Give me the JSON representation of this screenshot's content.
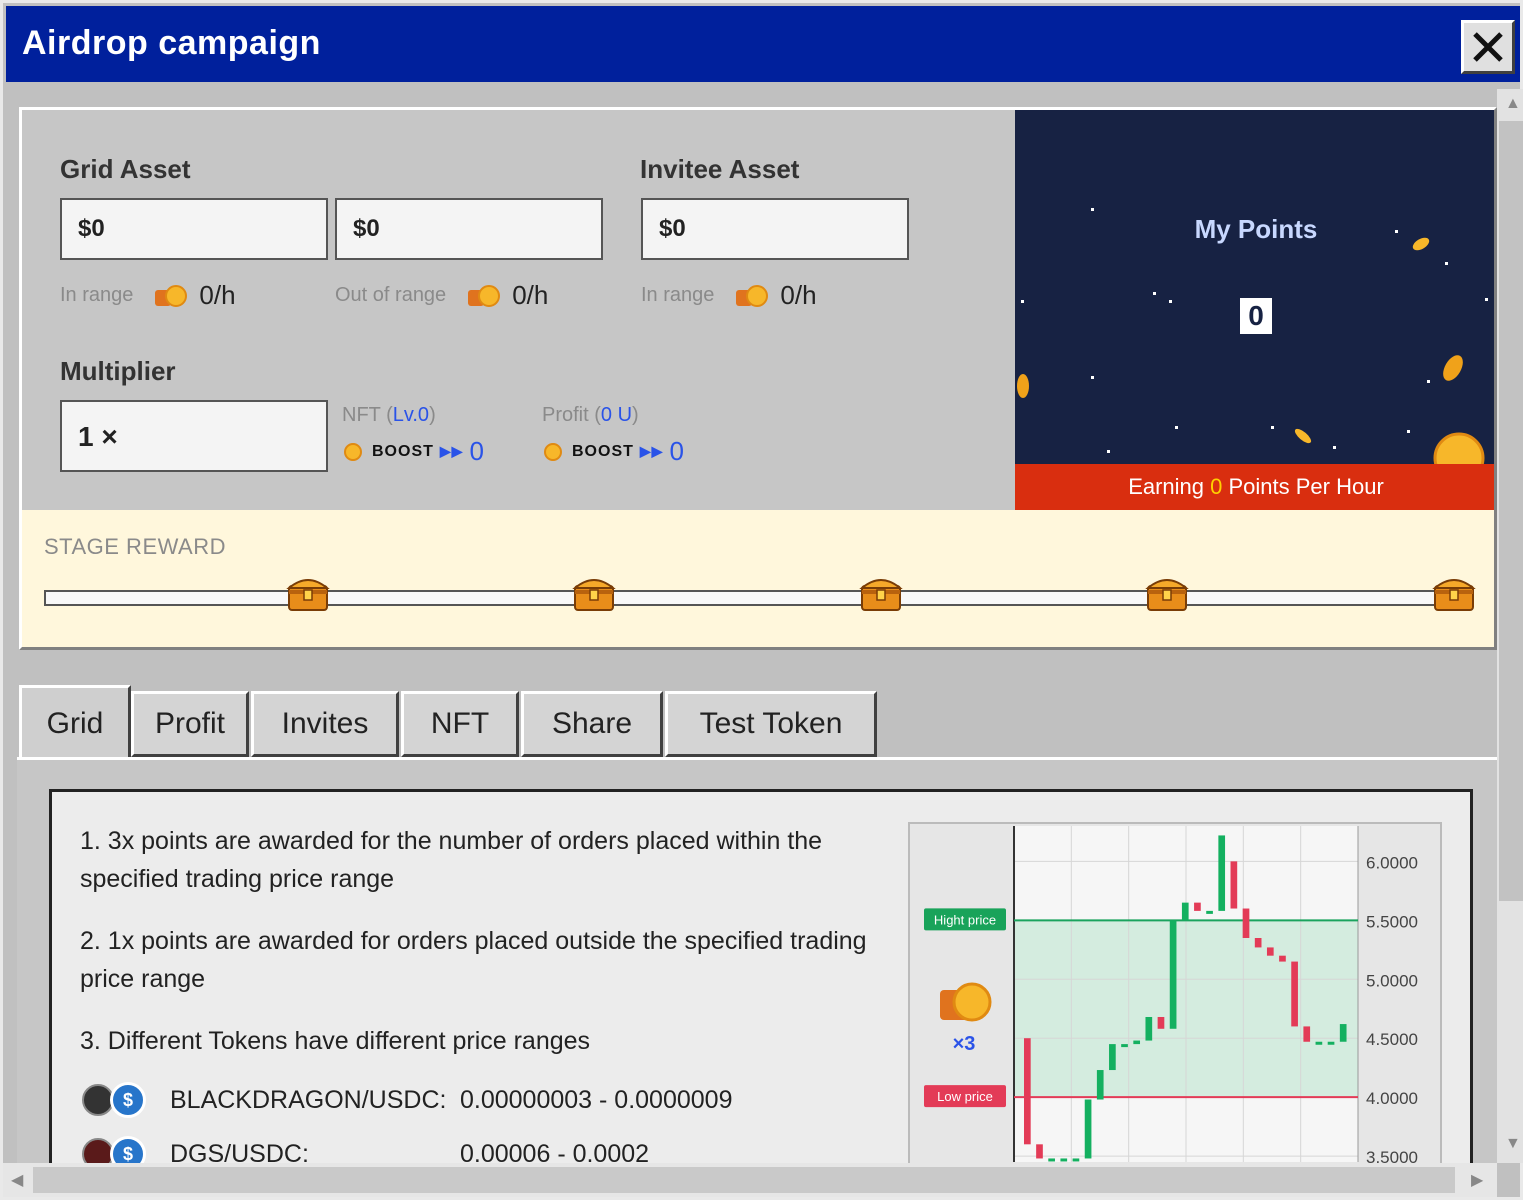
{
  "window": {
    "title": "Airdrop campaign"
  },
  "assets": {
    "grid_label": "Grid Asset",
    "invitee_label": "Invitee Asset",
    "grid_in_value": "$0",
    "grid_out_value": "$0",
    "invitee_value": "$0",
    "grid_in_caption": "In range",
    "grid_out_caption": "Out of range",
    "invitee_caption": "In range",
    "grid_in_rate": "0/h",
    "grid_out_rate": "0/h",
    "invitee_rate": "0/h"
  },
  "multiplier": {
    "label": "Multiplier",
    "value": "1 ×",
    "nft_prefix": "NFT (",
    "nft_level": "Lv.0",
    "nft_suffix": ")",
    "nft_boost_label": "BOOST",
    "nft_boost_value": "0",
    "profit_prefix": "Profit (",
    "profit_amount": "0 U",
    "profit_suffix": ")",
    "profit_boost_label": "BOOST",
    "profit_boost_value": "0"
  },
  "points": {
    "title": "My Points",
    "value": "0",
    "earning_prefix": "Earning ",
    "earning_value": "0",
    "earning_suffix": " Points Per Hour"
  },
  "stage_reward": {
    "label": "STAGE REWARD",
    "chest_count": 5,
    "progress": 0
  },
  "tabs": [
    {
      "label": "Grid",
      "active": true
    },
    {
      "label": "Profit",
      "active": false
    },
    {
      "label": "Invites",
      "active": false
    },
    {
      "label": "NFT",
      "active": false
    },
    {
      "label": "Share",
      "active": false
    },
    {
      "label": "Test Token",
      "active": false
    }
  ],
  "rules": [
    "1. 3x points are awarded for the number of orders placed within the specified trading price range",
    "2. 1x points are awarded for orders placed outside the specified trading price range",
    "3. Different Tokens have different price ranges"
  ],
  "tokens": [
    {
      "pair": "BLACKDRAGON/USDC:",
      "range": "0.00000003 - 0.0000009"
    },
    {
      "pair": "DGS/USDC:",
      "range": "0.00006 - 0.0002"
    }
  ],
  "chart_data": {
    "type": "candlestick",
    "y_ticks": [
      "6.0000",
      "5.5000",
      "5.0000",
      "4.5000",
      "4.0000",
      "3.5000"
    ],
    "ylim": [
      3.45,
      6.3
    ],
    "high_price": 5.5,
    "low_price": 4.0,
    "high_label": "Hight price",
    "low_label": "Low price",
    "multiplier_label": "×3",
    "colors": {
      "up": "#14b060",
      "down": "#e33b57",
      "band": "#d4ecdf"
    },
    "candles": [
      [
        4.5,
        3.6
      ],
      [
        3.6,
        3.48
      ],
      [
        3.48,
        3.48
      ],
      [
        3.48,
        3.48
      ],
      [
        3.48,
        3.48
      ],
      [
        3.48,
        3.98
      ],
      [
        3.98,
        4.23
      ],
      [
        4.23,
        4.45
      ],
      [
        4.45,
        4.45
      ],
      [
        4.45,
        4.48
      ],
      [
        4.48,
        4.68
      ],
      [
        4.68,
        4.58
      ],
      [
        4.58,
        5.5
      ],
      [
        5.5,
        5.65
      ],
      [
        5.65,
        5.58
      ],
      [
        5.58,
        5.58
      ],
      [
        5.58,
        6.22
      ],
      [
        6.0,
        5.6
      ],
      [
        5.6,
        5.35
      ],
      [
        5.35,
        5.27
      ],
      [
        5.27,
        5.2
      ],
      [
        5.2,
        5.15
      ],
      [
        5.15,
        4.6
      ],
      [
        4.6,
        4.47
      ],
      [
        4.47,
        4.47
      ],
      [
        4.47,
        4.47
      ],
      [
        4.47,
        4.62
      ]
    ]
  }
}
